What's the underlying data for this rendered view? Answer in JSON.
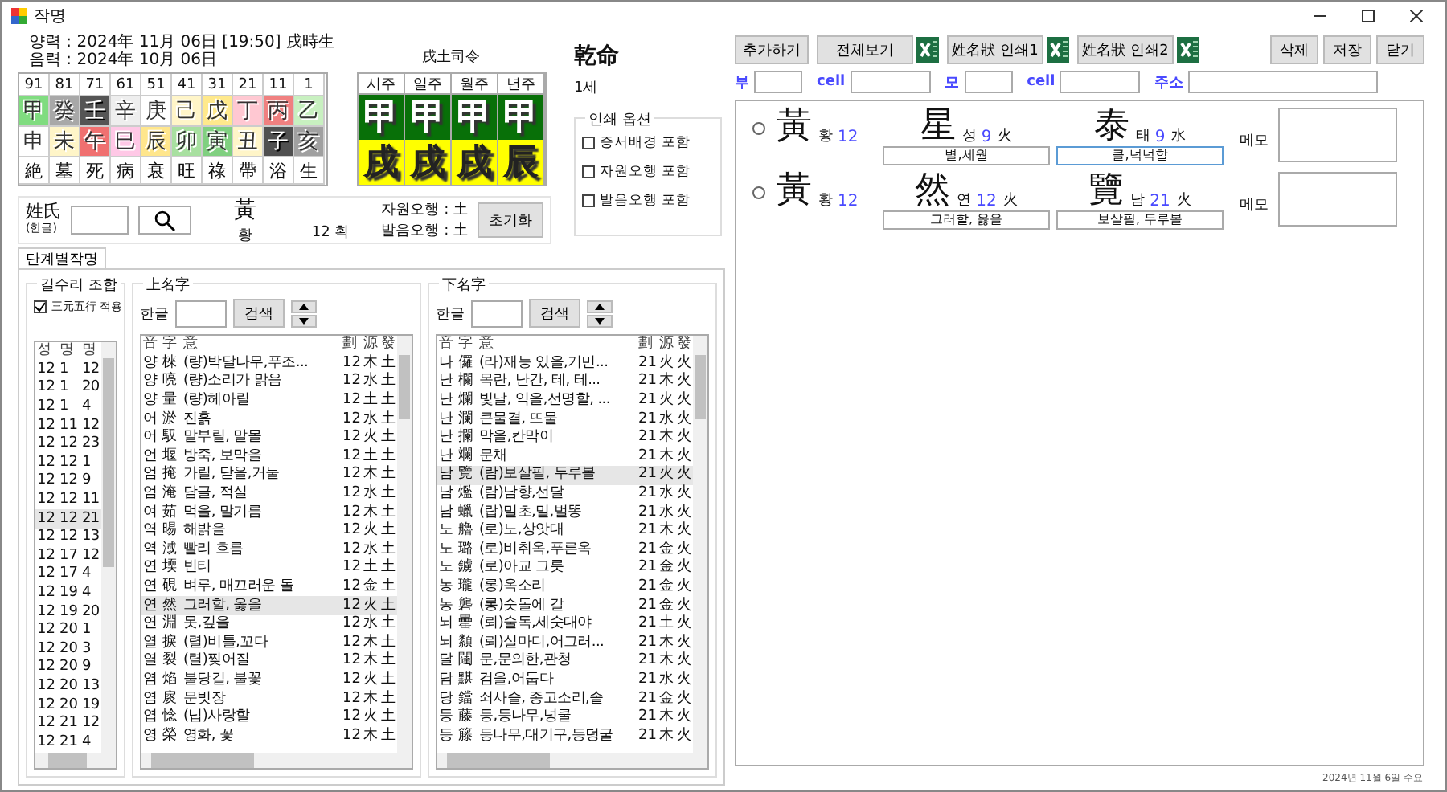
{
  "window": {
    "title": "작명"
  },
  "birth": {
    "solar": "양력 : 2024年  11月  06日  [19:50] 戌時生",
    "lunar": "음력 : 2024年  10月  06日"
  },
  "daewoon": {
    "ages": [
      "91",
      "81",
      "71",
      "61",
      "51",
      "41",
      "31",
      "21",
      "11",
      "1"
    ],
    "stems": [
      {
        "char": "甲",
        "color": "#80dc80"
      },
      {
        "char": "癸",
        "color": "#a8a8a8"
      },
      {
        "char": "壬",
        "color": "#555555"
      },
      {
        "char": "辛",
        "color": "#eeeeee"
      },
      {
        "char": "庚",
        "color": "#ffffff"
      },
      {
        "char": "己",
        "color": "#fff5c8"
      },
      {
        "char": "戊",
        "color": "#ffe98c"
      },
      {
        "char": "丁",
        "color": "#ffc8d2"
      },
      {
        "char": "丙",
        "color": "#f08080"
      },
      {
        "char": "乙",
        "color": "#c8f0c0"
      }
    ],
    "branches": [
      {
        "char": "申",
        "color": "#ffffff"
      },
      {
        "char": "未",
        "color": "#fff5c8"
      },
      {
        "char": "午",
        "color": "#f07070"
      },
      {
        "char": "巳",
        "color": "#ffc8e6"
      },
      {
        "char": "辰",
        "color": "#ffe68c"
      },
      {
        "char": "卯",
        "color": "#a8e0a0"
      },
      {
        "char": "寅",
        "color": "#80d080"
      },
      {
        "char": "丑",
        "color": "#fff5c8"
      },
      {
        "char": "子",
        "color": "#505050"
      },
      {
        "char": "亥",
        "color": "#a0a0a0"
      }
    ],
    "stages": [
      "絶",
      "墓",
      "死",
      "病",
      "衰",
      "旺",
      "祿",
      "帶",
      "浴",
      "生"
    ]
  },
  "saju": {
    "title": "戌土司令",
    "pillars": [
      {
        "label": "시주",
        "stem": "甲",
        "branch": "戌"
      },
      {
        "label": "일주",
        "stem": "甲",
        "branch": "戌"
      },
      {
        "label": "월주",
        "stem": "甲",
        "branch": "戌"
      },
      {
        "label": "년주",
        "stem": "甲",
        "branch": "辰"
      }
    ]
  },
  "gender": {
    "title": "乾命",
    "age": "1세"
  },
  "print_options": {
    "title": "인쇄 옵션",
    "items": [
      {
        "label": "증서배경 포함",
        "checked": false
      },
      {
        "label": "자원오행 포함",
        "checked": false
      },
      {
        "label": "발음오행 포함",
        "checked": false
      }
    ]
  },
  "surname": {
    "label": "姓氏",
    "sublabel": "(한글)",
    "hanja": "黃",
    "reading": "황",
    "strokes": "12 획",
    "source_element": "자원오행 : 土",
    "sound_element": "발음오행 : 土",
    "reset": "초기화"
  },
  "tabs": [
    {
      "label": "단계별작명",
      "selected": true
    }
  ],
  "combos": {
    "title": "길수리 조합",
    "option": {
      "label": "三元五行 적용",
      "checked": true
    },
    "columns": [
      "성",
      "명",
      "명"
    ],
    "rows": [
      {
        "cells": [
          "12",
          "1",
          "12"
        ],
        "selected": false
      },
      {
        "cells": [
          "12",
          "1",
          "20"
        ],
        "selected": false
      },
      {
        "cells": [
          "12",
          "1",
          "4"
        ],
        "selected": false
      },
      {
        "cells": [
          "12",
          "11",
          "12"
        ],
        "selected": false
      },
      {
        "cells": [
          "12",
          "12",
          "23"
        ],
        "selected": false
      },
      {
        "cells": [
          "12",
          "12",
          "1"
        ],
        "selected": false
      },
      {
        "cells": [
          "12",
          "12",
          "9"
        ],
        "selected": false
      },
      {
        "cells": [
          "12",
          "12",
          "11"
        ],
        "selected": false
      },
      {
        "cells": [
          "12",
          "12",
          "21"
        ],
        "selected": true
      },
      {
        "cells": [
          "12",
          "12",
          "13"
        ],
        "selected": false
      },
      {
        "cells": [
          "12",
          "17",
          "12"
        ],
        "selected": false
      },
      {
        "cells": [
          "12",
          "17",
          "4"
        ],
        "selected": false
      },
      {
        "cells": [
          "12",
          "19",
          "4"
        ],
        "selected": false
      },
      {
        "cells": [
          "12",
          "19",
          "20"
        ],
        "selected": false
      },
      {
        "cells": [
          "12",
          "20",
          "1"
        ],
        "selected": false
      },
      {
        "cells": [
          "12",
          "20",
          "3"
        ],
        "selected": false
      },
      {
        "cells": [
          "12",
          "20",
          "9"
        ],
        "selected": false
      },
      {
        "cells": [
          "12",
          "20",
          "13"
        ],
        "selected": false
      },
      {
        "cells": [
          "12",
          "20",
          "19"
        ],
        "selected": false
      },
      {
        "cells": [
          "12",
          "21",
          "12"
        ],
        "selected": false
      },
      {
        "cells": [
          "12",
          "21",
          "4"
        ],
        "selected": false
      }
    ]
  },
  "upper_name": {
    "title": "上名字",
    "search_label": "한글",
    "search_button": "검색",
    "columns": [
      "音",
      "字",
      "意",
      "劃",
      "源",
      "發"
    ],
    "rows": [
      {
        "cells": [
          "양",
          "棶",
          "(량)박달나무,푸조...",
          "12",
          "木",
          "土"
        ],
        "selected": false
      },
      {
        "cells": [
          "양",
          "喨",
          "(량)소리가 맑음",
          "12",
          "水",
          "土"
        ],
        "selected": false
      },
      {
        "cells": [
          "양",
          "量",
          "(량)헤아릴",
          "12",
          "土",
          "土"
        ],
        "selected": false
      },
      {
        "cells": [
          "어",
          "淤",
          "진흙",
          "12",
          "水",
          "土"
        ],
        "selected": false
      },
      {
        "cells": [
          "어",
          "馭",
          "말부릴, 말몰",
          "12",
          "火",
          "土"
        ],
        "selected": false
      },
      {
        "cells": [
          "언",
          "堰",
          "방죽, 보막을",
          "12",
          "土",
          "土"
        ],
        "selected": false
      },
      {
        "cells": [
          "엄",
          "掩",
          "가릴, 닫을,거둘",
          "12",
          "木",
          "土"
        ],
        "selected": false
      },
      {
        "cells": [
          "엄",
          "淹",
          "담글, 적실",
          "12",
          "水",
          "土"
        ],
        "selected": false
      },
      {
        "cells": [
          "여",
          "茹",
          "먹을, 말기름",
          "12",
          "木",
          "土"
        ],
        "selected": false
      },
      {
        "cells": [
          "역",
          "晹",
          "해밝을",
          "12",
          "火",
          "土"
        ],
        "selected": false
      },
      {
        "cells": [
          "역",
          "淢",
          "빨리 흐름",
          "12",
          "水",
          "土"
        ],
        "selected": false
      },
      {
        "cells": [
          "연",
          "堧",
          "빈터",
          "12",
          "土",
          "土"
        ],
        "selected": false
      },
      {
        "cells": [
          "연",
          "硯",
          "벼루, 매끄러운 돌",
          "12",
          "金",
          "土"
        ],
        "selected": false
      },
      {
        "cells": [
          "연",
          "然",
          "그러할, 옳을",
          "12",
          "火",
          "土"
        ],
        "selected": true
      },
      {
        "cells": [
          "연",
          "淵",
          "못,깊을",
          "12",
          "水",
          "土"
        ],
        "selected": false
      },
      {
        "cells": [
          "열",
          "捩",
          "(렬)비틀,꼬다",
          "12",
          "木",
          "土"
        ],
        "selected": false
      },
      {
        "cells": [
          "열",
          "裂",
          "(렬)찢어질",
          "12",
          "木",
          "土"
        ],
        "selected": false
      },
      {
        "cells": [
          "염",
          "焰",
          "불당길, 불꽃",
          "12",
          "火",
          "土"
        ],
        "selected": false
      },
      {
        "cells": [
          "염",
          "扊",
          "문빗장",
          "12",
          "木",
          "土"
        ],
        "selected": false
      },
      {
        "cells": [
          "엽",
          "惗",
          "(넙)사랑할",
          "12",
          "火",
          "土"
        ],
        "selected": false
      },
      {
        "cells": [
          "영",
          "榮",
          "영화, 꽃",
          "12",
          "木",
          "土"
        ],
        "selected": false
      }
    ]
  },
  "lower_name": {
    "title": "下名字",
    "search_label": "한글",
    "search_button": "검색",
    "columns": [
      "音",
      "字",
      "意",
      "劃",
      "源",
      "發"
    ],
    "rows": [
      {
        "cells": [
          "나",
          "儸",
          "(라)재능 있을,기민...",
          "21",
          "火",
          "火"
        ],
        "selected": false
      },
      {
        "cells": [
          "난",
          "欄",
          "목란, 난간, 테, 테...",
          "21",
          "木",
          "火"
        ],
        "selected": false
      },
      {
        "cells": [
          "난",
          "爛",
          "빛날, 익을,선명할, ...",
          "21",
          "火",
          "火"
        ],
        "selected": false
      },
      {
        "cells": [
          "난",
          "瀾",
          "큰물결, 뜨물",
          "21",
          "水",
          "火"
        ],
        "selected": false
      },
      {
        "cells": [
          "난",
          "攔",
          "막을,칸막이",
          "21",
          "木",
          "火"
        ],
        "selected": false
      },
      {
        "cells": [
          "난",
          "斕",
          "문채",
          "21",
          "木",
          "火"
        ],
        "selected": false
      },
      {
        "cells": [
          "남",
          "覽",
          "(람)보살필, 두루볼",
          "21",
          "火",
          "火"
        ],
        "selected": true
      },
      {
        "cells": [
          "남",
          "爁",
          "(람)남향,선달",
          "21",
          "水",
          "火"
        ],
        "selected": false
      },
      {
        "cells": [
          "남",
          "蠟",
          "(랍)밀초,밀,벌똥",
          "21",
          "水",
          "火"
        ],
        "selected": false
      },
      {
        "cells": [
          "노",
          "艪",
          "(로)노,상앗대",
          "21",
          "木",
          "火"
        ],
        "selected": false
      },
      {
        "cells": [
          "노",
          "璐",
          "(로)비취옥,푸른옥",
          "21",
          "金",
          "火"
        ],
        "selected": false
      },
      {
        "cells": [
          "노",
          "鐪",
          "(로)아교 그릇",
          "21",
          "金",
          "火"
        ],
        "selected": false
      },
      {
        "cells": [
          "농",
          "瓏",
          "(롱)옥소리",
          "21",
          "金",
          "火"
        ],
        "selected": false
      },
      {
        "cells": [
          "농",
          "礱",
          "(롱)숫돌에 갈",
          "21",
          "金",
          "火"
        ],
        "selected": false
      },
      {
        "cells": [
          "뇌",
          "罍",
          "(뢰)술독,세숫대야",
          "21",
          "土",
          "火"
        ],
        "selected": false
      },
      {
        "cells": [
          "뇌",
          "纇",
          "(뢰)실마디,어그러...",
          "21",
          "木",
          "火"
        ],
        "selected": false
      },
      {
        "cells": [
          "달",
          "闥",
          "문,문의한,관청",
          "21",
          "木",
          "火"
        ],
        "selected": false
      },
      {
        "cells": [
          "담",
          "黮",
          "검을,어둡다",
          "21",
          "水",
          "火"
        ],
        "selected": false
      },
      {
        "cells": [
          "당",
          "鐺",
          "쇠사슬, 종고소리,솥",
          "21",
          "金",
          "火"
        ],
        "selected": false
      },
      {
        "cells": [
          "등",
          "藤",
          "등,등나무,넝쿨",
          "21",
          "木",
          "火"
        ],
        "selected": false
      },
      {
        "cells": [
          "등",
          "籐",
          "등나무,대기구,등덩굴",
          "21",
          "木",
          "火"
        ],
        "selected": false
      }
    ]
  },
  "toolbar": [
    {
      "label": "추가하기",
      "kind": "button"
    },
    {
      "label": "전체보기",
      "kind": "export"
    },
    {
      "label": "姓名狀 인쇄1",
      "kind": "export"
    },
    {
      "label": "姓名狀 인쇄2",
      "kind": "export"
    },
    {
      "label": "삭제",
      "kind": "button"
    },
    {
      "label": "저장",
      "kind": "button"
    },
    {
      "label": "닫기",
      "kind": "button"
    }
  ],
  "fields": [
    {
      "label": "부"
    },
    {
      "label": "cell"
    },
    {
      "label": "모"
    },
    {
      "label": "cell"
    },
    {
      "label": "주소"
    }
  ],
  "candidates": [
    {
      "selected": false,
      "surname": {
        "hanja": "黃",
        "reading": "황",
        "strokes": "12"
      },
      "given": [
        {
          "hanja": "星",
          "reading": "성",
          "strokes": "9",
          "element": "火",
          "meaning": "별,세월",
          "focused": false
        },
        {
          "hanja": "泰",
          "reading": "태",
          "strokes": "9",
          "element": "水",
          "meaning": "클,넉넉할",
          "focused": true
        }
      ],
      "memo_label": "메모"
    },
    {
      "selected": false,
      "surname": {
        "hanja": "黃",
        "reading": "황",
        "strokes": "12"
      },
      "given": [
        {
          "hanja": "然",
          "reading": "연",
          "strokes": "12",
          "element": "火",
          "meaning": "그러할, 옳을",
          "focused": false
        },
        {
          "hanja": "覽",
          "reading": "남",
          "strokes": "21",
          "element": "火",
          "meaning": "보살필, 두루볼",
          "focused": false
        }
      ],
      "memo_label": "메모"
    }
  ],
  "status_bar": {
    "date": "2024년 11월 6일 수요"
  }
}
